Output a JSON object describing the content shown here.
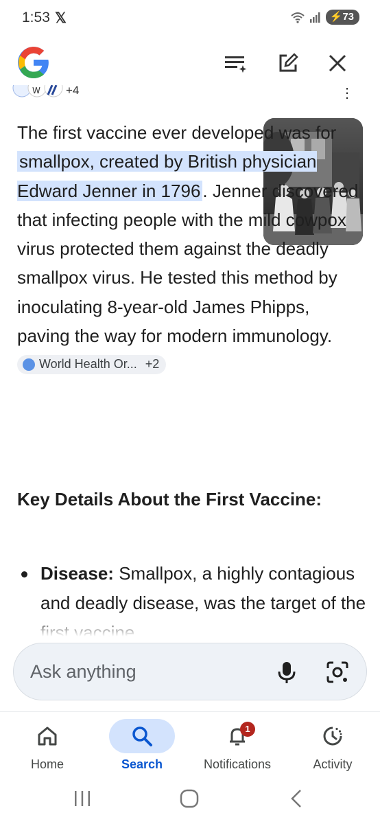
{
  "status_bar": {
    "time": "1:53",
    "social_icon": "x-logo",
    "wifi_label": "5",
    "battery": "73"
  },
  "header": {
    "logo": "google-g-logo",
    "actions": [
      "ai-list-icon",
      "edit-icon",
      "close-icon"
    ]
  },
  "answer": {
    "source_more": "+4",
    "intro": "The first vaccine ever developed was for ",
    "highlight": "smallpox, created by British physician Edward Jenner in 1796",
    "body": ". Jenner discovered that infecting people with the mild cowpox virus protected them against the deadly smallpox virus. He tested this method by inoculating 8-year-old James Phipps, paving the way for modern immunology.",
    "citation": {
      "label": "World Health Or...",
      "more": "+2"
    }
  },
  "section": {
    "heading": "Key Details About the First Vaccine:",
    "bullets": [
      {
        "term": "Disease:",
        "text": " Smallpox, a highly contagious and deadly disease, was the target of the first vaccine."
      }
    ]
  },
  "search": {
    "placeholder": "Ask anything"
  },
  "nav": {
    "items": [
      {
        "label": "Home",
        "icon": "home-icon"
      },
      {
        "label": "Search",
        "icon": "search-icon",
        "active": true
      },
      {
        "label": "Notifications",
        "icon": "bell-icon",
        "badge": "1"
      },
      {
        "label": "Activity",
        "icon": "activity-icon"
      }
    ]
  },
  "colors": {
    "highlight": "#d3e3fd",
    "accent": "#0b57d0",
    "badge": "#b3261e"
  }
}
